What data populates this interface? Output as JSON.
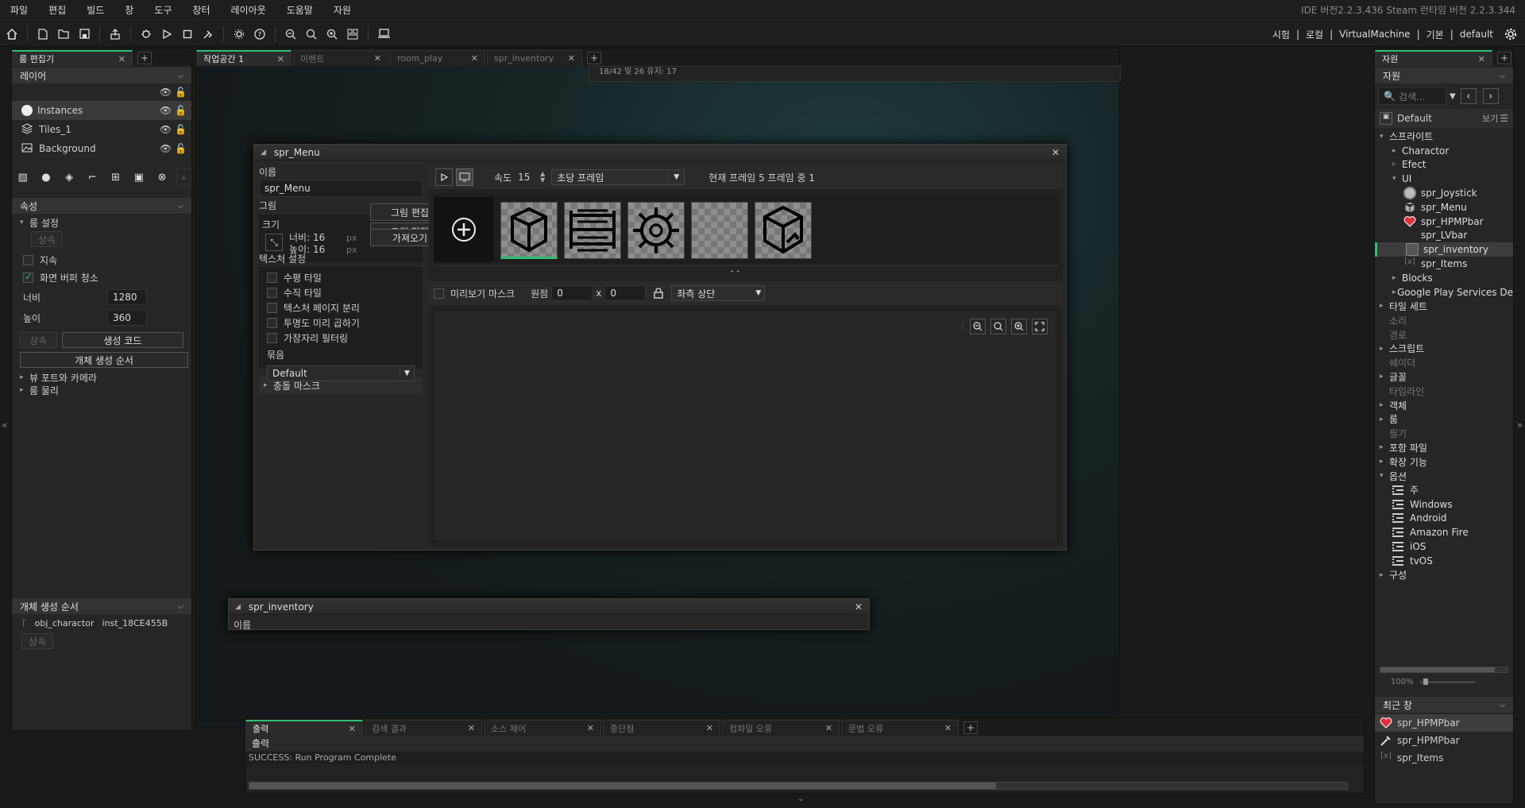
{
  "menu": [
    "파일",
    "편집",
    "빌드",
    "창",
    "도구",
    "창터",
    "레이아웃",
    "도움말",
    "자원"
  ],
  "version_text": "IDE 버전2.2.3.436 Steam 런타임 버전 2.2.3.344",
  "toolbar_right": {
    "items": [
      "시험",
      "로컬",
      "VirtualMachine",
      "기본",
      "default"
    ],
    "sep": "|"
  },
  "left_panel": {
    "tab_label": "룸 편집기",
    "layers_header": "레이어",
    "layers": [
      {
        "name": "Instances",
        "icon": "instance-circle-icon"
      },
      {
        "name": "Tiles_1",
        "icon": "tiles-stack-icon"
      },
      {
        "name": "Background",
        "icon": "background-image-icon"
      }
    ],
    "properties_header": "속성",
    "room_settings": "룸 설정",
    "inherit": "상속",
    "persistent": "지속",
    "clear_display": "화면 버퍼 청소",
    "width_label": "너비",
    "width_value": "1280",
    "height_label": "높이",
    "height_value": "360",
    "inherit2": "상속",
    "creation_code": "생성 코드",
    "instance_order": "개체 생성 순서",
    "viewports": "뷰 포트와 카메라",
    "physics": "룸 물리",
    "search_fragment": "ㅅ",
    "bottom_header": "개체 생성 순서",
    "bottom_obj": "obj_charactor",
    "bottom_inst": "inst_18CE455B",
    "bottom_inherit": "상속"
  },
  "center_tabs": [
    {
      "label": "작업공간 1",
      "active": true
    },
    {
      "label": "이벤트",
      "active": false
    },
    {
      "label": "room_play",
      "active": false
    },
    {
      "label": "spr_inventory",
      "active": false
    }
  ],
  "bg_text": "18/42 및 26 유지: 17",
  "sprite_editor": {
    "title": "spr_Menu",
    "name_label": "이름",
    "name_value": "spr_Menu",
    "image_label": "그림",
    "size_label": "크기",
    "width_label": "너비:",
    "width_value": "16",
    "height_label": "높이:",
    "height_value": "16",
    "unit": "px",
    "edit_image": "그림 편집",
    "import": "가져오기",
    "texture_settings": "텍스처 설정",
    "checkboxes": [
      "수평 타일",
      "수직 타일",
      "텍스처 페이지 분리",
      "투명도 미리 곱하기",
      "가장자리 필터링"
    ],
    "group_label": "묶음",
    "group_value": "Default",
    "collision_mask": "충돌 마스크",
    "speed_label": "속도",
    "speed_value": "15",
    "speed_unit": "초당 프레임",
    "frame_info": "현재 프레임 5 프레임 중 1",
    "preview_mask": "미리보기 마스크",
    "origin_label": "원점",
    "origin_x": "0",
    "origin_x_sep": "x",
    "origin_y": "0",
    "origin_preset": "좌측 상단"
  },
  "sprite_inventory": {
    "title": "spr_inventory",
    "name_label": "이름"
  },
  "bottom_panel": {
    "tabs": [
      {
        "label": "출력",
        "active": true
      },
      {
        "label": "검색 결과",
        "active": false
      },
      {
        "label": "소스 제어",
        "active": false
      },
      {
        "label": "중단점",
        "active": false
      },
      {
        "label": "컴파일 오류",
        "active": false
      },
      {
        "label": "문법 오류",
        "active": false
      }
    ],
    "output_header": "출력",
    "output_line": "SUCCESS: Run Program Complete"
  },
  "right_panel": {
    "tab_label": "자원",
    "header": "자원",
    "search_placeholder": "검색...",
    "default_label": "Default",
    "view_label": "보기",
    "tree": [
      {
        "label": "스프라이트",
        "level": 0,
        "arrow": "▾"
      },
      {
        "label": "Charactor",
        "level": 1,
        "arrow": "▸"
      },
      {
        "label": "Efect",
        "level": 1,
        "arrow": "▹"
      },
      {
        "label": "UI",
        "level": 1,
        "arrow": "▾"
      },
      {
        "label": "spr_Joystick",
        "level": 2,
        "icon": "joystick"
      },
      {
        "label": "spr_Menu",
        "level": 2,
        "icon": "menu"
      },
      {
        "label": "spr_HPMPbar",
        "level": 2,
        "icon": "heart"
      },
      {
        "label": "spr_LVbar",
        "level": 2,
        "icon": "lvbar"
      },
      {
        "label": "spr_inventory",
        "level": 2,
        "icon": "inventory",
        "selected": true
      },
      {
        "label": "spr_Items",
        "level": 2,
        "icon": "items"
      },
      {
        "label": "Blocks",
        "level": 1,
        "arrow": "▸"
      },
      {
        "label": "Google Play Services De",
        "level": 1,
        "arrow": "▸"
      },
      {
        "label": "타일 세트",
        "level": 0,
        "arrow": "▸"
      },
      {
        "label": "소리",
        "level": 0,
        "dim": true
      },
      {
        "label": "경로",
        "level": 0,
        "dim": true
      },
      {
        "label": "스크립트",
        "level": 0,
        "arrow": "▸"
      },
      {
        "label": "쉐이더",
        "level": 0,
        "dim": true
      },
      {
        "label": "글꼴",
        "level": 0,
        "arrow": "▸"
      },
      {
        "label": "타임라인",
        "level": 0,
        "dim": true
      },
      {
        "label": "객체",
        "level": 0,
        "arrow": "▸"
      },
      {
        "label": "룸",
        "level": 0,
        "arrow": "▸"
      },
      {
        "label": "필기",
        "level": 0,
        "dim": true
      },
      {
        "label": "포함 파일",
        "level": 0,
        "arrow": "▸"
      },
      {
        "label": "확장 기능",
        "level": 0,
        "arrow": "▸"
      },
      {
        "label": "옵션",
        "level": 0,
        "arrow": "▾"
      },
      {
        "label": "주",
        "level": 1,
        "icon": "list"
      },
      {
        "label": "Windows",
        "level": 1,
        "icon": "list"
      },
      {
        "label": "Android",
        "level": 1,
        "icon": "list"
      },
      {
        "label": "Amazon Fire",
        "level": 1,
        "icon": "list"
      },
      {
        "label": "iOS",
        "level": 1,
        "icon": "list"
      },
      {
        "label": "tvOS",
        "level": 1,
        "icon": "list"
      },
      {
        "label": "구성",
        "level": 0,
        "arrow": "▸"
      }
    ],
    "zoom": "100%",
    "recent_header": "최근 창",
    "recent": [
      {
        "label": "spr_HPMPbar",
        "icon": "heart",
        "selected": true
      },
      {
        "label": "spr_HPMPbar",
        "icon": "brush"
      },
      {
        "label": "spr_Items",
        "icon": "items"
      }
    ]
  },
  "colors": {
    "accent": "#2fbf71",
    "heart": "#e0303a"
  }
}
